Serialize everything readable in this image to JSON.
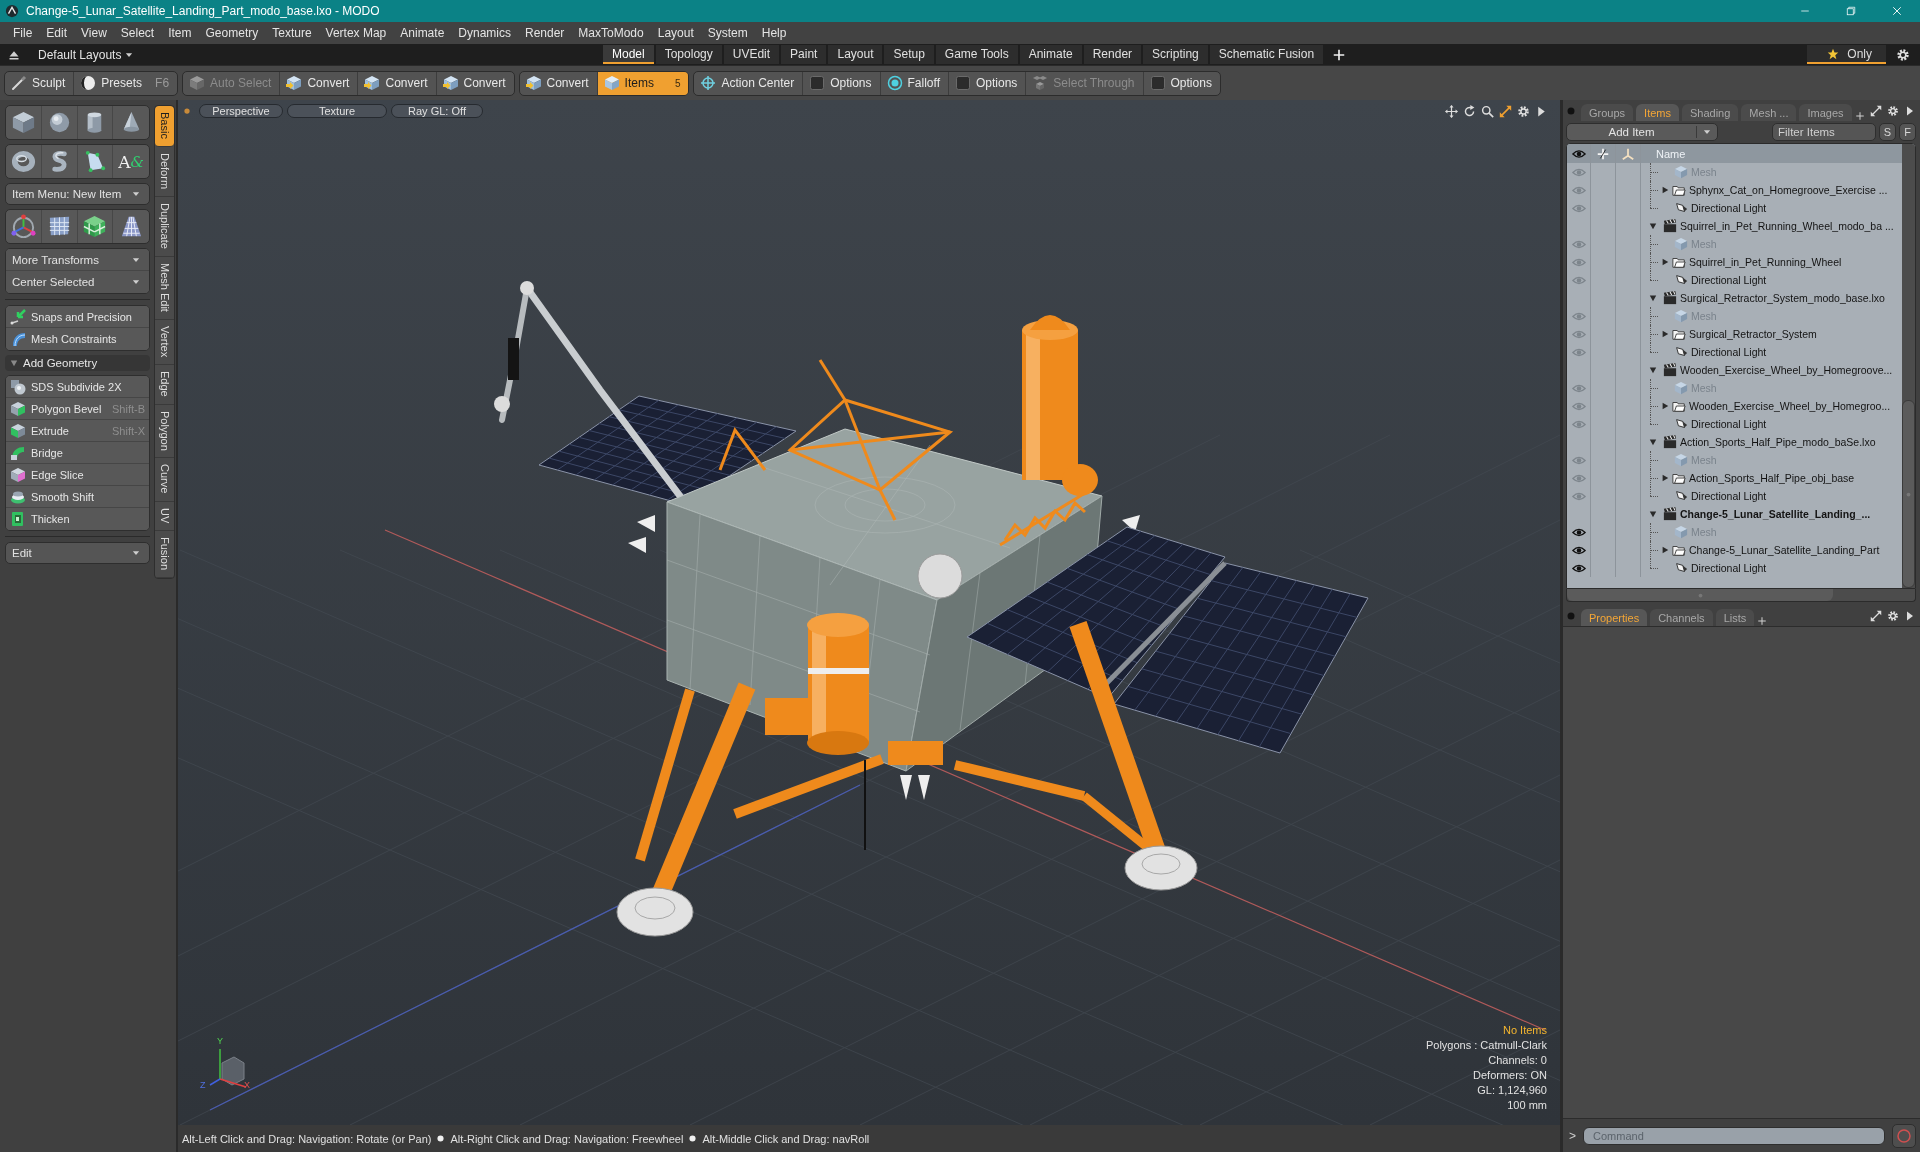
{
  "window": {
    "title": "Change-5_Lunar_Satellite_Landing_Part_modo_base.lxo - MODO"
  },
  "menu": [
    "File",
    "Edit",
    "View",
    "Select",
    "Item",
    "Geometry",
    "Texture",
    "Vertex Map",
    "Animate",
    "Dynamics",
    "Render",
    "MaxToModo",
    "Layout",
    "System",
    "Help"
  ],
  "layout_bar": {
    "preset": "Default Layouts",
    "tabs": [
      {
        "label": "Model",
        "selected": true
      },
      {
        "label": "Topology",
        "selected": false
      },
      {
        "label": "UVEdit",
        "selected": false
      },
      {
        "label": "Paint",
        "selected": false
      },
      {
        "label": "Layout",
        "selected": false
      },
      {
        "label": "Setup",
        "selected": false
      },
      {
        "label": "Game Tools",
        "selected": false
      },
      {
        "label": "Animate",
        "selected": false
      },
      {
        "label": "Render",
        "selected": false
      },
      {
        "label": "Scripting",
        "selected": false
      },
      {
        "label": "Schematic Fusion",
        "selected": false
      }
    ],
    "only": {
      "label": "Only",
      "on": true
    }
  },
  "toolbar": {
    "groups": [
      {
        "buttons": [
          {
            "kind": "sculpt",
            "label": "Sculpt",
            "selected": false,
            "disabled": false
          },
          {
            "kind": "presets",
            "label": "Presets",
            "shortcut": "F6",
            "selected": false,
            "disabled": false
          }
        ]
      },
      {
        "buttons": [
          {
            "kind": "auto-select",
            "label": "Auto Select",
            "selected": false,
            "disabled": true
          },
          {
            "kind": "convert",
            "label": "Convert",
            "selected": false,
            "disabled": false
          },
          {
            "kind": "convert",
            "label": "Convert",
            "selected": false,
            "disabled": false
          },
          {
            "kind": "convert",
            "label": "Convert",
            "selected": false,
            "disabled": false
          }
        ]
      },
      {
        "buttons": [
          {
            "kind": "convert",
            "label": "Convert",
            "selected": false,
            "disabled": false
          },
          {
            "kind": "items",
            "label": "Items",
            "badge": "5",
            "selected": true,
            "disabled": false
          }
        ]
      },
      {
        "buttons": [
          {
            "kind": "action-center",
            "label": "Action Center",
            "selected": false,
            "disabled": false
          },
          {
            "kind": "toggle",
            "label": "Options",
            "selected": false,
            "disabled": false
          },
          {
            "kind": "falloff",
            "label": "Falloff",
            "selected": false,
            "disabled": false
          },
          {
            "kind": "toggle",
            "label": "Options",
            "selected": false,
            "disabled": false
          },
          {
            "kind": "select-through",
            "label": "Select Through",
            "selected": false,
            "disabled": true
          },
          {
            "kind": "toggle",
            "label": "Options",
            "selected": false,
            "disabled": false
          }
        ]
      }
    ]
  },
  "tool_panel": {
    "primitives": [
      [
        {
          "kind": "cube"
        },
        {
          "kind": "sphere"
        },
        {
          "kind": "cylinder"
        },
        {
          "kind": "cone"
        }
      ],
      [
        {
          "kind": "torus"
        },
        {
          "kind": "capsule"
        },
        {
          "kind": "pen"
        },
        {
          "kind": "text",
          "glyph": "A&"
        }
      ]
    ],
    "item_menu": "Item Menu: New Item",
    "transform_tools": [
      {
        "kind": "gizmo"
      },
      {
        "kind": "grid-plane"
      },
      {
        "kind": "checker-cube"
      },
      {
        "kind": "grid-pyramid"
      }
    ],
    "transform_menus": [
      "More Transforms",
      "Center Selected"
    ],
    "snapping": [
      {
        "kind": "snap",
        "label": "Snaps and Precision"
      },
      {
        "kind": "constraint",
        "label": "Mesh Constraints"
      }
    ],
    "add_geometry": {
      "label": "Add Geometry",
      "expanded": true,
      "tools": [
        {
          "kind": "sds",
          "label": "SDS Subdivide 2X"
        },
        {
          "kind": "bevel",
          "label": "Polygon Bevel",
          "shortcut": "Shift-B"
        },
        {
          "kind": "extrude",
          "label": "Extrude",
          "shortcut": "Shift-X"
        },
        {
          "kind": "bridge",
          "label": "Bridge"
        },
        {
          "kind": "edge-slice",
          "label": "Edge Slice"
        },
        {
          "kind": "smooth-shift",
          "label": "Smooth Shift"
        },
        {
          "kind": "thicken",
          "label": "Thicken"
        }
      ]
    },
    "edit_menu": "Edit",
    "side_tabs": [
      {
        "label": "Basic",
        "selected": true
      },
      {
        "label": "Deform",
        "selected": false
      },
      {
        "label": "Duplicate",
        "selected": false
      },
      {
        "label": "Mesh Edit",
        "selected": false
      },
      {
        "label": "Vertex",
        "selected": false
      },
      {
        "label": "Edge",
        "selected": false
      },
      {
        "label": "Polygon",
        "selected": false
      },
      {
        "label": "Curve",
        "selected": false
      },
      {
        "label": "UV",
        "selected": false
      },
      {
        "label": "Fusion",
        "selected": false
      }
    ]
  },
  "viewport": {
    "view_buttons": [
      "Perspective",
      "Texture",
      "Ray GL: Off"
    ],
    "info": {
      "status": "No Items",
      "lines": [
        "Polygons : Catmull-Clark",
        "Channels: 0",
        "Deformers: ON",
        "GL: 1,124,960",
        "100 mm"
      ]
    },
    "axis_labels": [
      "Y",
      "X",
      "Z"
    ]
  },
  "items_panel": {
    "tabs": [
      {
        "label": "Groups",
        "selected": false
      },
      {
        "label": "Items",
        "selected": true
      },
      {
        "label": "Shading",
        "selected": false
      },
      {
        "label": "Mesh ...",
        "selected": false
      },
      {
        "label": "Images",
        "selected": false
      }
    ],
    "add_item": "Add Item",
    "filter": {
      "placeholder": "Filter Items"
    },
    "filter_buttons": [
      "S",
      "F"
    ],
    "name_column": "Name",
    "tree": [
      {
        "kind": "scene-scrolled",
        "current": false,
        "children": [
          {
            "kind": "mesh",
            "label": "Mesh"
          },
          {
            "kind": "group",
            "label": "Sphynx_Cat_on_Homegroove_Exercise ...",
            "expanded": false
          },
          {
            "kind": "light",
            "label": "Directional Light"
          }
        ]
      },
      {
        "kind": "scene",
        "label": "Squirrel_in_Pet_Running_Wheel_modo_ba ...",
        "expanded": true,
        "current": false,
        "children": [
          {
            "kind": "mesh",
            "label": "Mesh"
          },
          {
            "kind": "group",
            "label": "Squirrel_in_Pet_Running_Wheel",
            "expanded": false
          },
          {
            "kind": "light",
            "label": "Directional Light"
          }
        ]
      },
      {
        "kind": "scene",
        "label": "Surgical_Retractor_System_modo_base.lxo",
        "expanded": true,
        "current": false,
        "children": [
          {
            "kind": "mesh",
            "label": "Mesh"
          },
          {
            "kind": "group",
            "label": "Surgical_Retractor_System",
            "expanded": false
          },
          {
            "kind": "light",
            "label": "Directional Light"
          }
        ]
      },
      {
        "kind": "scene",
        "label": "Wooden_Exercise_Wheel_by_Homegroove...",
        "expanded": true,
        "current": false,
        "children": [
          {
            "kind": "mesh",
            "label": "Mesh"
          },
          {
            "kind": "group",
            "label": "Wooden_Exercise_Wheel_by_Homegroo...",
            "expanded": false
          },
          {
            "kind": "light",
            "label": "Directional Light"
          }
        ]
      },
      {
        "kind": "scene",
        "label": "Action_Sports_Half_Pipe_modo_baSe.lxo",
        "expanded": true,
        "current": false,
        "children": [
          {
            "kind": "mesh",
            "label": "Mesh"
          },
          {
            "kind": "group",
            "label": "Action_Sports_Half_Pipe_obj_base",
            "expanded": false
          },
          {
            "kind": "light",
            "label": "Directional Light"
          }
        ]
      },
      {
        "kind": "scene",
        "label": "Change-5_Lunar_Satellite_Landing_...",
        "expanded": true,
        "current": true,
        "children": [
          {
            "kind": "mesh",
            "label": "Mesh"
          },
          {
            "kind": "group",
            "label": "Change-5_Lunar_Satellite_Landing_Part",
            "expanded": false
          },
          {
            "kind": "light",
            "label": "Directional Light"
          }
        ]
      }
    ]
  },
  "properties_panel": {
    "tabs": [
      {
        "label": "Properties",
        "selected": true
      },
      {
        "label": "Channels",
        "selected": false
      },
      {
        "label": "Lists",
        "selected": false
      }
    ],
    "prompt": ">",
    "command": {
      "placeholder": "Command"
    }
  },
  "status_bar": {
    "hints": [
      "Alt-Left Click and Drag: Navigation: Rotate (or Pan)",
      "Alt-Right Click and Drag: Navigation: Freewheel",
      "Alt-Middle Click and Drag: navRoll"
    ]
  }
}
